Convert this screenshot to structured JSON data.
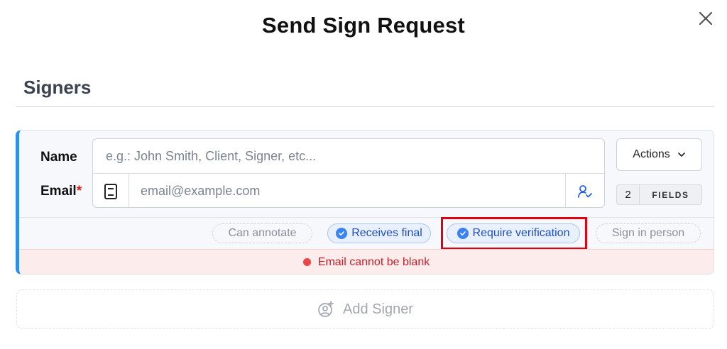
{
  "dialog": {
    "title": "Send Sign Request",
    "close_icon": "close-icon"
  },
  "section": {
    "title": "Signers"
  },
  "signer": {
    "accent_color": "#2f8fe8",
    "name_label": "Name",
    "email_label": "Email",
    "required_mark": "*",
    "name_value": "",
    "name_placeholder": "e.g.: John Smith, Client, Signer, etc...",
    "email_value": "",
    "email_placeholder": "email@example.com",
    "address_book_icon": "address-book-icon",
    "contact_icon": "user-check-icon",
    "actions_label": "Actions",
    "fields_count": "2",
    "fields_label": "FIELDS",
    "options": [
      {
        "label": "Can annotate",
        "active": false
      },
      {
        "label": "Receives final",
        "active": true
      },
      {
        "label": "Require verification",
        "active": true
      },
      {
        "label": "Sign in person",
        "active": false
      }
    ],
    "error_message": "Email cannot be blank",
    "error_color": "#c8202a"
  },
  "add_signer": {
    "label": "Add Signer",
    "icon": "add-user-icon"
  },
  "highlight_color": "#e0000f"
}
